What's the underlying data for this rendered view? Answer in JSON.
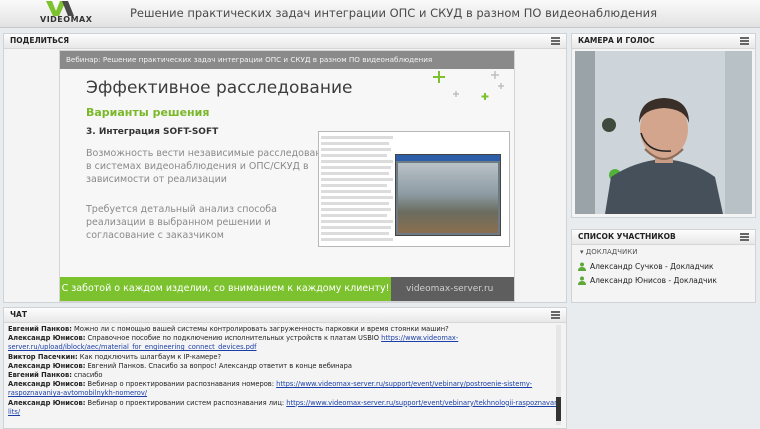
{
  "app": {
    "logo_text": "VIDEOMAX",
    "title": "Решение практических задач интеграции ОПС и СКУД в разном ПО видеонаблюдения"
  },
  "share_pod": {
    "title": "ПОДЕЛИТЬСЯ",
    "slide": {
      "header": "Вебинар: Решение практических задач интеграции ОПС и СКУД в разном ПО видеонаблюдения",
      "heading": "Эффективное расследование",
      "subheading": "Варианты решения",
      "item": "3.   Интеграция SOFT-SOFT",
      "para1": "Возможность вести независимые расследования в системах видеонаблюдения и ОПС/СКУД в зависимости от реализации",
      "para2": "Требуется детальный анализ способа реализации в выбранном решении и согласование с заказчиком",
      "footer_slogan": "С заботой о каждом изделии, со вниманием к каждому клиенту!",
      "footer_site": "videomax-server.ru"
    }
  },
  "camera_pod": {
    "title": "КАМЕРА И ГОЛОС"
  },
  "attendees_pod": {
    "title": "СПИСОК УЧАСТНИКОВ",
    "group": "ДОКЛАДЧИКИ",
    "items": [
      {
        "name": "Александр Сучков - Докладчик"
      },
      {
        "name": "Александр Юнисов - Докладчик"
      }
    ]
  },
  "chat_pod": {
    "title": "ЧАТ",
    "messages": [
      {
        "author": "Евгений Панков:",
        "text": " Можно ли с помощью вашей системы контролировать загруженность парковки и время стоянки машин?",
        "link": ""
      },
      {
        "author": "Александр Юнисов:",
        "text": " Справочное пособие по подключению исполнительных устройств к платам USBIO ",
        "link": "https://www.videomax-"
      },
      {
        "author": "",
        "text": "",
        "link": "server.ru/upload/iblock/aec/material_for_engineering_connect_devices.pdf"
      },
      {
        "author": "Виктор Пасечкин:",
        "text": " Как подключить шлагбаум к IP-камере?",
        "link": ""
      },
      {
        "author": "Александр Юнисов:",
        "text": " Евгений Панков. Спасибо за вопрос! Александр ответит в конце вебинара",
        "link": ""
      },
      {
        "author": "Евгений Панков:",
        "text": " спасибо",
        "link": ""
      },
      {
        "author": "Александр Юнисов:",
        "text": " Вебинар о проектировании распознавания номеров: ",
        "link": "https://www.videomax-server.ru/support/event/vebinary/postroenie-sistemy-"
      },
      {
        "author": "",
        "text": "",
        "link": "raspoznavaniya-avtomobilnykh-nomerov/"
      },
      {
        "author": "Александр Юнисов:",
        "text": " Вебинар о проектировании систем распознавания лиц: ",
        "link": "https://www.videomax-server.ru/support/event/vebinary/tekhnologii-raspoznavaniya-"
      },
      {
        "author": "",
        "text": "",
        "link": "lits/"
      }
    ]
  },
  "colors": {
    "accent_green": "#7cc22e",
    "link": "#1a3fa8"
  }
}
